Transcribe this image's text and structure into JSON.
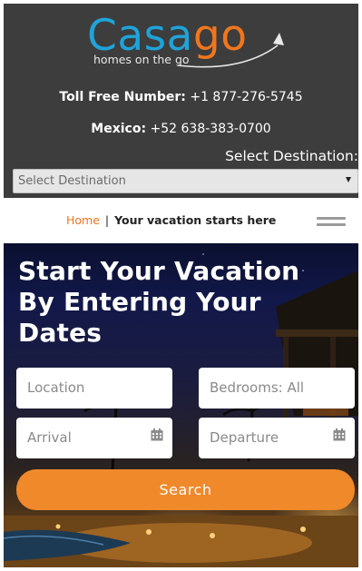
{
  "brand": {
    "logo_text_blue": "Casa",
    "logo_text_orange": "go",
    "tagline": "homes on the go",
    "colors": {
      "blue": "#1fa3d9",
      "orange": "#f0761c",
      "header_bg": "#3d3d3d"
    }
  },
  "contact": {
    "toll_free_label": "Toll Free Number:",
    "toll_free_number": "+1 877-276-5745",
    "mexico_label": "Mexico:",
    "mexico_number": "+52 638-383-0700"
  },
  "destination": {
    "label": "Select Destination:",
    "selected": "Select Destination"
  },
  "breadcrumb": {
    "home": "Home",
    "separator": "|",
    "current": "Your vacation starts here"
  },
  "hero": {
    "heading": "Start Your Vacation By Entering Your Dates"
  },
  "search_form": {
    "location_placeholder": "Location",
    "bedrooms_value": "Bedrooms: All",
    "arrival_placeholder": "Arrival",
    "departure_placeholder": "Departure",
    "search_label": "Search",
    "button_color": "#f0892a"
  },
  "icons": {
    "menu": "hamburger-menu-icon",
    "calendar": "calendar-icon",
    "dropdown": "chevron-down-icon",
    "logo_arrow": "arrow-up-icon"
  }
}
